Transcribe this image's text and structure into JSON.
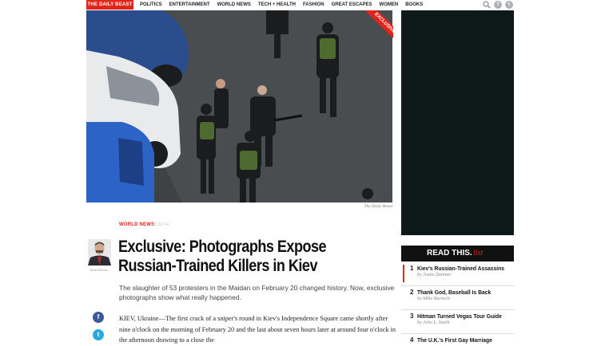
{
  "header": {
    "brand": "THE DAILY BEAST",
    "nav": [
      "POLITICS",
      "ENTERTAINMENT",
      "WORLD NEWS",
      "TECH + HEALTH",
      "FASHION",
      "GREAT ESCAPES",
      "WOMEN",
      "BOOKS"
    ],
    "icons": [
      "search-icon",
      "facebook-icon",
      "twitter-icon"
    ]
  },
  "hero": {
    "ribbon": "EXCLUSIVE",
    "caption": "The Daily Beast"
  },
  "article": {
    "section": "WORLD NEWS",
    "date": "03.30.14",
    "author": "Jamie Dettmer",
    "headline": "Exclusive: Photographs Expose Russian-Trained Killers in Kiev",
    "dek": "The slaughter of 53 protesters in the Maidan on February 20 changed history. Now, exclusive photographs show what really happened.",
    "body": "KIEV, Ukraine—The first crack of a sniper's round in Kiev's Independence Square came shortly after nine o'clock on the morning of February 20 and the last about seven hours later at around four o'clock in the afternoon drawing to a close the"
  },
  "sidebar": {
    "read_this": "READ THIS.",
    "read_this_suffix": "list",
    "items": [
      {
        "num": "1",
        "title": "Kiev's Russian-Trained Assassins",
        "byline": "by Jamie Dettmer"
      },
      {
        "num": "2",
        "title": "Thank God, Baseball Is Back",
        "byline": "by Mike Barnicle"
      },
      {
        "num": "3",
        "title": "Hitman Turned Vegas Tour Guide",
        "byline": "by John L. Smith"
      },
      {
        "num": "4",
        "title": "The U.K.'s First Gay Marriage",
        "byline": ""
      }
    ]
  },
  "colors": {
    "brand_red": "#e3241b",
    "ad_bg": "#0d1a19"
  }
}
